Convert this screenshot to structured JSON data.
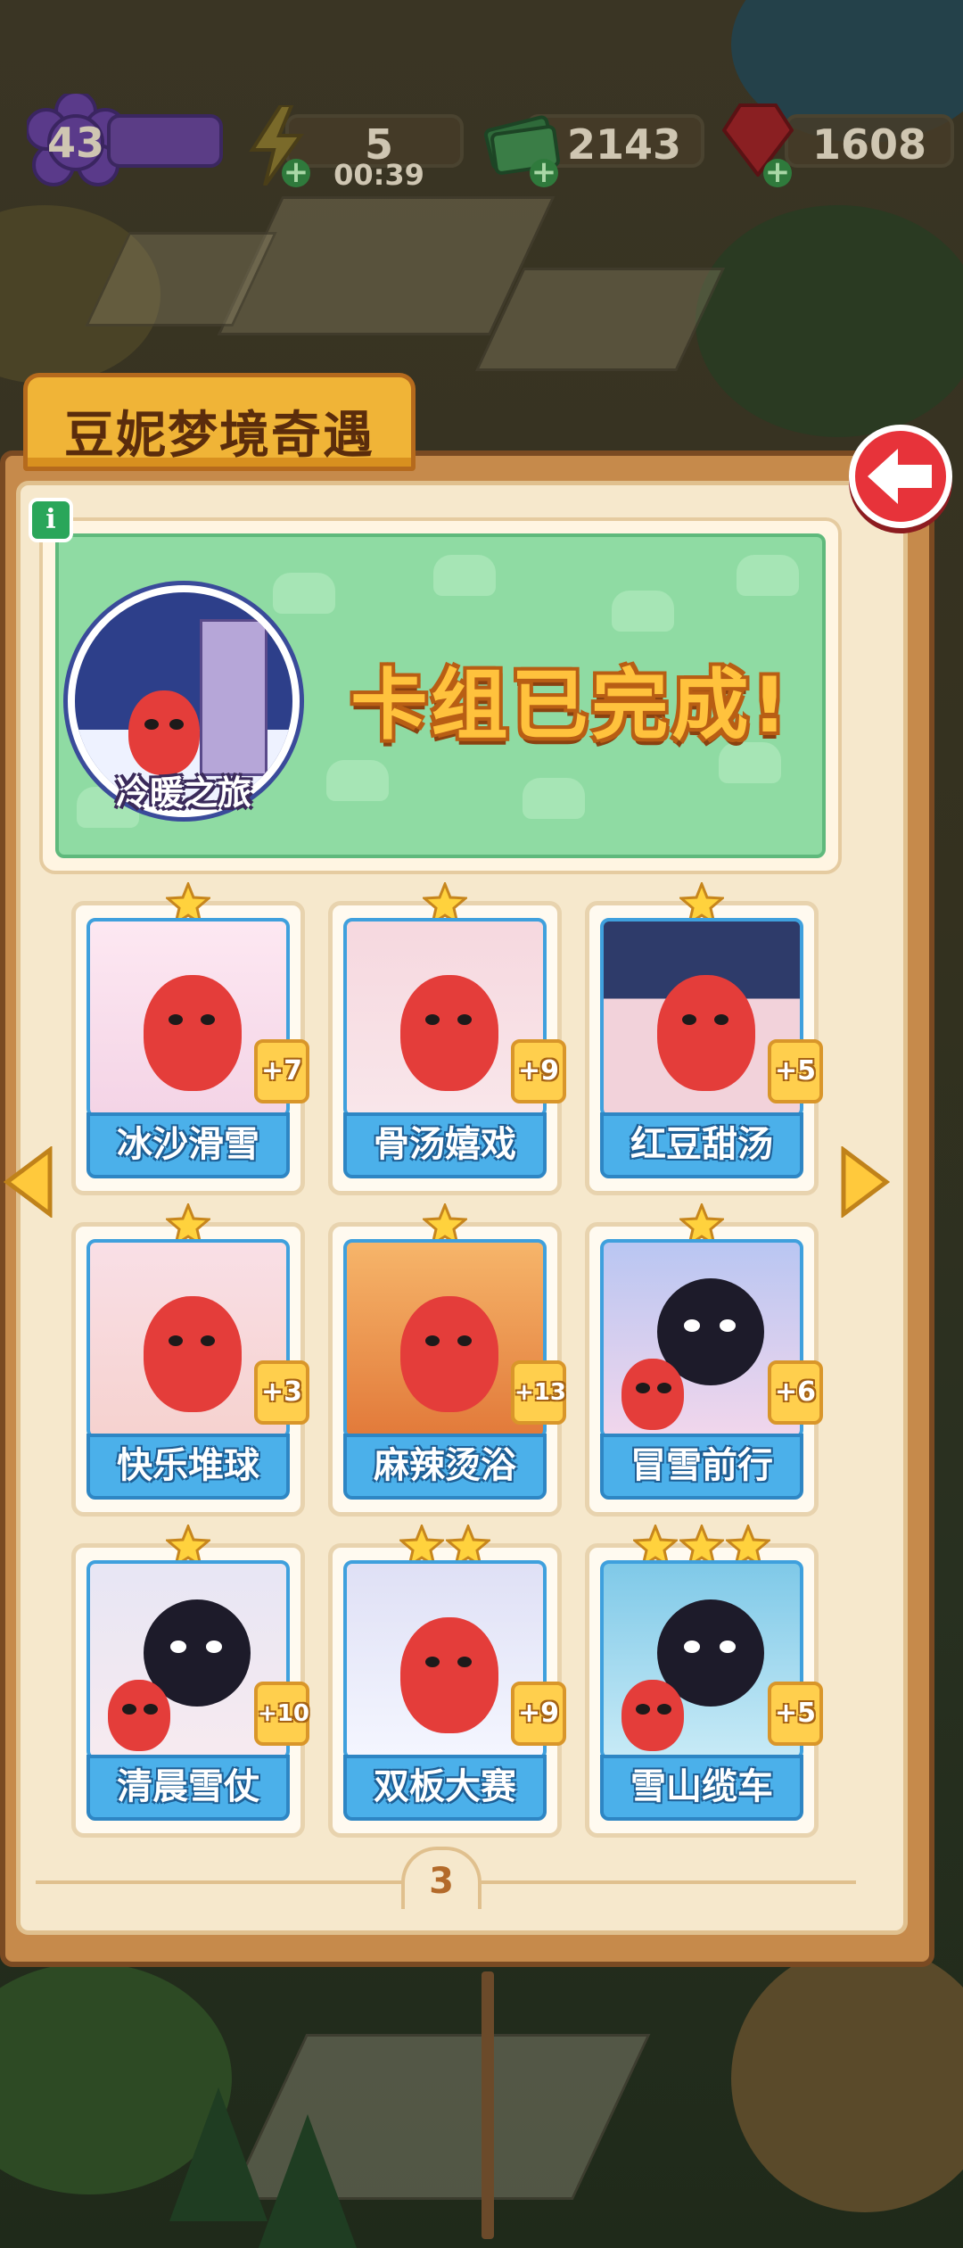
{
  "hud": {
    "level": "43",
    "energy": "5",
    "energy_timer": "00:39",
    "cash": "2143",
    "gems": "1608"
  },
  "panel": {
    "title": "豆妮梦境奇遇",
    "deck_name": "冷暖之旅",
    "status": "卡组已完成!",
    "page": "3"
  },
  "cards": [
    {
      "name": "冰沙滑雪",
      "count": "+7",
      "stars": 1
    },
    {
      "name": "骨汤嬉戏",
      "count": "+9",
      "stars": 1
    },
    {
      "name": "红豆甜汤",
      "count": "+5",
      "stars": 1
    },
    {
      "name": "快乐堆球",
      "count": "+3",
      "stars": 1
    },
    {
      "name": "麻辣烫浴",
      "count": "+13",
      "stars": 1
    },
    {
      "name": "冒雪前行",
      "count": "+6",
      "stars": 1
    },
    {
      "name": "清晨雪仗",
      "count": "+10",
      "stars": 1
    },
    {
      "name": "双板大赛",
      "count": "+9",
      "stars": 2
    },
    {
      "name": "雪山缆车",
      "count": "+5",
      "stars": 3
    }
  ],
  "colors": {
    "accent": "#f0b437",
    "card_label": "#4bb0ea",
    "back_button": "#e7333a",
    "banner": "#8fdba3"
  },
  "icons": {
    "back": "back-arrow-icon",
    "info": "info-icon",
    "energy": "lightning-icon",
    "cash": "cash-icon",
    "gems": "ruby-icon",
    "star": "star-icon"
  }
}
